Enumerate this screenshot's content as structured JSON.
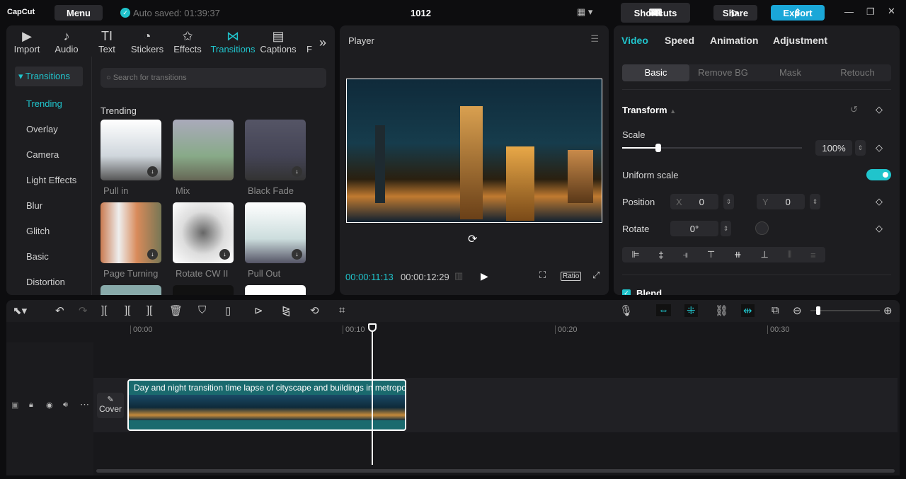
{
  "app": {
    "logo": "CapCut",
    "menu": "Menu",
    "autosave": "Auto saved: 01:39:37",
    "project": "1012",
    "shortcuts": "Shortcuts",
    "share": "Share",
    "export": "Export"
  },
  "tabs": [
    {
      "label": "Import",
      "icon": "▶"
    },
    {
      "label": "Audio",
      "icon": "♪"
    },
    {
      "label": "Text",
      "icon": "TI"
    },
    {
      "label": "Stickers",
      "icon": "◔"
    },
    {
      "label": "Effects",
      "icon": "✩"
    },
    {
      "label": "Transitions",
      "icon": "⋈"
    },
    {
      "label": "Captions",
      "icon": "▤"
    },
    {
      "label": "F",
      "icon": ""
    }
  ],
  "sidebar": {
    "header": "Transitions",
    "items": [
      "Trending",
      "Overlay",
      "Camera",
      "Light Effects",
      "Blur",
      "Glitch",
      "Basic",
      "Distortion"
    ]
  },
  "search": {
    "placeholder": "Search for transitions"
  },
  "section": "Trending",
  "transitions": [
    "Pull in",
    "Mix",
    "Black Fade",
    "Page Turning",
    "Rotate CW II",
    "Pull Out"
  ],
  "player": {
    "title": "Player",
    "current": "00:00:11:13",
    "total": "00:00:12:29",
    "ratio": "Ratio"
  },
  "right": {
    "tabs": [
      "Video",
      "Speed",
      "Animation",
      "Adjustment"
    ],
    "subtabs": [
      "Basic",
      "Remove BG",
      "Mask",
      "Retouch"
    ],
    "transform": "Transform",
    "scale_label": "Scale",
    "scale": "100%",
    "scale_fraction": 0.2,
    "uniform": "Uniform scale",
    "uniform_on": true,
    "position": "Position",
    "x_label": "X",
    "x": "0",
    "y_label": "Y",
    "y": "0",
    "rotate": "Rotate",
    "rotate_val": "0°",
    "blend": "Blend"
  },
  "timeline": {
    "ticks": [
      "00:00",
      "00:10",
      "00:20",
      "00:30"
    ],
    "clip_title": "Day and night transition time lapse of cityscape and buildings in metropolis",
    "cover": "Cover"
  },
  "colors": {
    "accent": "#20c4cc",
    "export": "#1aa7d8"
  }
}
